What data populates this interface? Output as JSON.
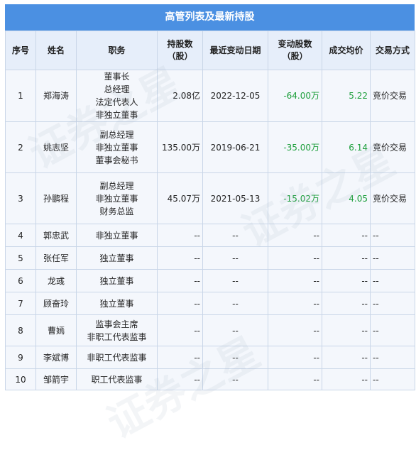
{
  "title": "高管列表及最新持股",
  "headers": [
    "序号",
    "姓名",
    "职务",
    "持股数（股）",
    "最近变动日期",
    "变动股数（股）",
    "成交均价",
    "交易方式"
  ],
  "watermark": "证券之星",
  "colors": {
    "header_bar": "#4b90e2",
    "header_row": "#e6eefa",
    "row_bg": "#f4f7fc",
    "negative_change": "#1b9e3a"
  },
  "rows": [
    {
      "idx": "1",
      "name": "郑海涛",
      "duties": [
        "董事长",
        "总经理",
        "法定代表人",
        "非独立董事"
      ],
      "shares": "2.08亿",
      "date": "2022-12-05",
      "change": "-64.00万",
      "price": "5.22",
      "method": "竞价交易"
    },
    {
      "idx": "2",
      "name": "姚志坚",
      "duties": [
        "副总经理",
        "非独立董事",
        "董事会秘书"
      ],
      "shares": "135.00万",
      "date": "2019-06-21",
      "change": "-35.00万",
      "price": "6.14",
      "method": "竞价交易"
    },
    {
      "idx": "3",
      "name": "孙鹏程",
      "duties": [
        "副总经理",
        "非独立董事",
        "财务总监"
      ],
      "shares": "45.07万",
      "date": "2021-05-13",
      "change": "-15.02万",
      "price": "4.05",
      "method": "竞价交易"
    },
    {
      "idx": "4",
      "name": "郭忠武",
      "duties": [
        "非独立董事"
      ],
      "shares": "--",
      "date": "--",
      "change": "--",
      "price": "--",
      "method": "--"
    },
    {
      "idx": "5",
      "name": "张任军",
      "duties": [
        "独立董事"
      ],
      "shares": "--",
      "date": "--",
      "change": "--",
      "price": "--",
      "method": "--"
    },
    {
      "idx": "6",
      "name": "龙彧",
      "duties": [
        "独立董事"
      ],
      "shares": "--",
      "date": "--",
      "change": "--",
      "price": "--",
      "method": "--"
    },
    {
      "idx": "7",
      "name": "顾奋玲",
      "duties": [
        "独立董事"
      ],
      "shares": "--",
      "date": "--",
      "change": "--",
      "price": "--",
      "method": "--"
    },
    {
      "idx": "8",
      "name": "曹嫣",
      "duties": [
        "监事会主席",
        "非职工代表监事"
      ],
      "shares": "--",
      "date": "--",
      "change": "--",
      "price": "--",
      "method": "--"
    },
    {
      "idx": "9",
      "name": "李斌博",
      "duties": [
        "非职工代表监事"
      ],
      "shares": "--",
      "date": "--",
      "change": "--",
      "price": "--",
      "method": "--"
    },
    {
      "idx": "10",
      "name": "邹箭宇",
      "duties": [
        "职工代表监事"
      ],
      "shares": "--",
      "date": "--",
      "change": "--",
      "price": "--",
      "method": "--"
    }
  ]
}
